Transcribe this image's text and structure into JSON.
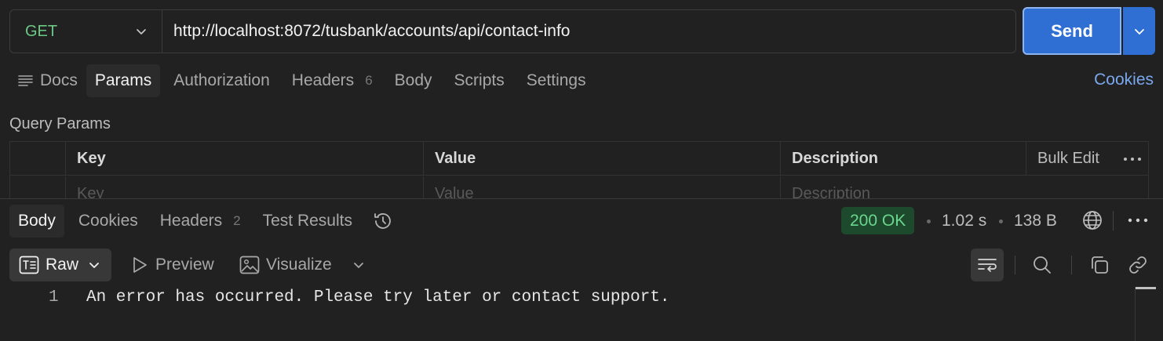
{
  "request": {
    "method": "GET",
    "url": "http://localhost:8072/tusbank/accounts/api/contact-info",
    "send_label": "Send"
  },
  "request_tabs": {
    "docs": "Docs",
    "params": "Params",
    "authorization": "Authorization",
    "headers": "Headers",
    "headers_count": "6",
    "body": "Body",
    "scripts": "Scripts",
    "settings": "Settings",
    "cookies": "Cookies"
  },
  "query_params": {
    "title": "Query Params",
    "columns": {
      "key": "Key",
      "value": "Value",
      "description": "Description",
      "bulk_edit": "Bulk Edit"
    },
    "placeholders": {
      "key": "Key",
      "value": "Value",
      "description": "Description"
    }
  },
  "response": {
    "tabs": {
      "body": "Body",
      "cookies": "Cookies",
      "headers": "Headers",
      "headers_count": "2",
      "test_results": "Test Results"
    },
    "status": "200 OK",
    "time": "1.02 s",
    "size": "138 B",
    "format": {
      "raw": "Raw",
      "preview": "Preview",
      "visualize": "Visualize"
    },
    "lines": [
      {
        "number": "1",
        "text": "An error has occurred. Please try later or contact support."
      }
    ]
  },
  "colors": {
    "background": "#212121",
    "accent_blue": "#2f6fd4",
    "method_green": "#6bc985",
    "status_green": "#6bd68d",
    "link_blue": "#7aa8ee"
  },
  "icons": [
    "chevron-down-icon",
    "docs-list-icon",
    "more-icon",
    "history-icon",
    "globe-icon",
    "raw-text-icon",
    "play-icon",
    "image-icon",
    "wrap-icon",
    "search-icon",
    "copy-icon",
    "link-icon"
  ]
}
